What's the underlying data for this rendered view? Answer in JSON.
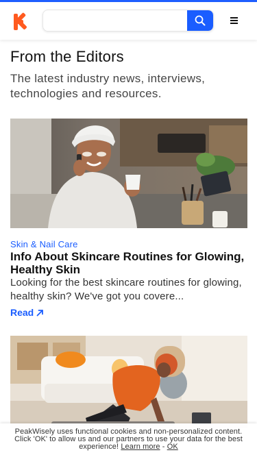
{
  "header": {
    "logo_color": "#ff5a1f",
    "search": {
      "value": "",
      "placeholder": "",
      "button_color": "#1a5dff"
    },
    "menu_icon": "hamburger-menu-icon"
  },
  "intro": {
    "title": "From the Editors",
    "subtitle": "The latest industry news, interviews, technologies and resources."
  },
  "articles": [
    {
      "category": "Skin & Nail Care",
      "title": "Info About Skincare Routines for Glowing, Healthy Skin",
      "excerpt": "Looking for the best skincare routines for glowing, healthy skin? We've got you covere...",
      "read_label": "Read",
      "image": "woman-in-bathrobe-with-eye-patches-on-phone"
    },
    {
      "image": "woman-doing-yoga-stretch-in-living-room"
    }
  ],
  "cookie_notice": {
    "text": "PeakWisely uses functional cookies and non-personalized content. Click 'OK' to allow us and our partners to use your data for the best experience!",
    "learn_more": "Learn more",
    "separator": "-",
    "ok_label": "OK"
  },
  "colors": {
    "accent": "#1a5dff",
    "brand": "#ff5a1f"
  }
}
